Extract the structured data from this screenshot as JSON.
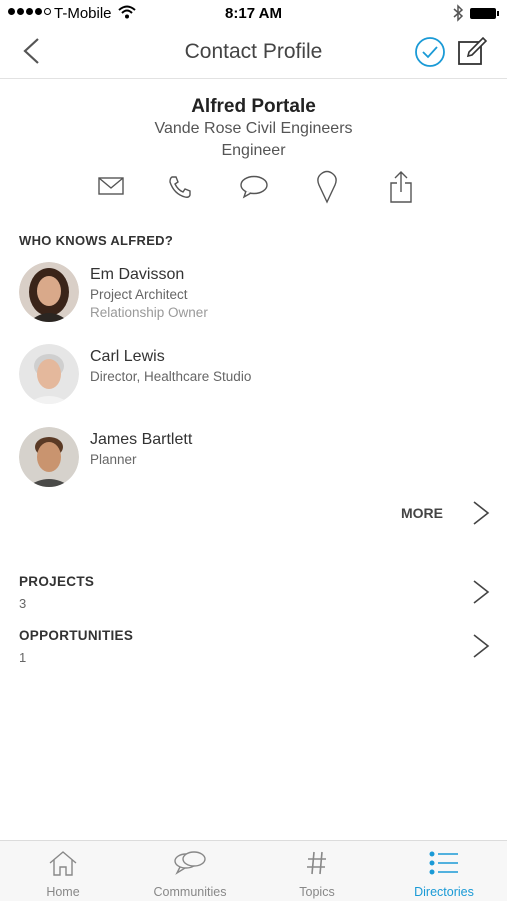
{
  "status_bar": {
    "carrier": "T-Mobile",
    "time": "8:17 AM"
  },
  "nav": {
    "title": "Contact Profile"
  },
  "contact": {
    "name": "Alfred Portale",
    "company": "Vande Rose Civil Engineers",
    "role": "Engineer"
  },
  "actions": [
    "mail-icon",
    "phone-icon",
    "message-icon",
    "location-pin-icon",
    "share-icon"
  ],
  "who_knows": {
    "heading": "WHO KNOWS ALFRED?",
    "people": [
      {
        "name": "Em Davisson",
        "title": "Project Architect",
        "extra": "Relationship Owner"
      },
      {
        "name": "Carl Lewis",
        "title": "Director, Healthcare Studio",
        "extra": ""
      },
      {
        "name": "James Bartlett",
        "title": "Planner",
        "extra": ""
      }
    ],
    "more_label": "MORE"
  },
  "projects": {
    "label": "PROJECTS",
    "count": "3"
  },
  "opportunities": {
    "label": "OPPORTUNITIES",
    "count": "1"
  },
  "tabbar": {
    "tabs": [
      {
        "label": "Home",
        "icon": "home-icon"
      },
      {
        "label": "Communities",
        "icon": "communities-icon"
      },
      {
        "label": "Topics",
        "icon": "hash-icon"
      },
      {
        "label": "Directories",
        "icon": "list-icon"
      }
    ],
    "active": "Directories"
  },
  "colors": {
    "accent": "#1a9ad6",
    "text": "#333333",
    "muted": "#888888"
  }
}
